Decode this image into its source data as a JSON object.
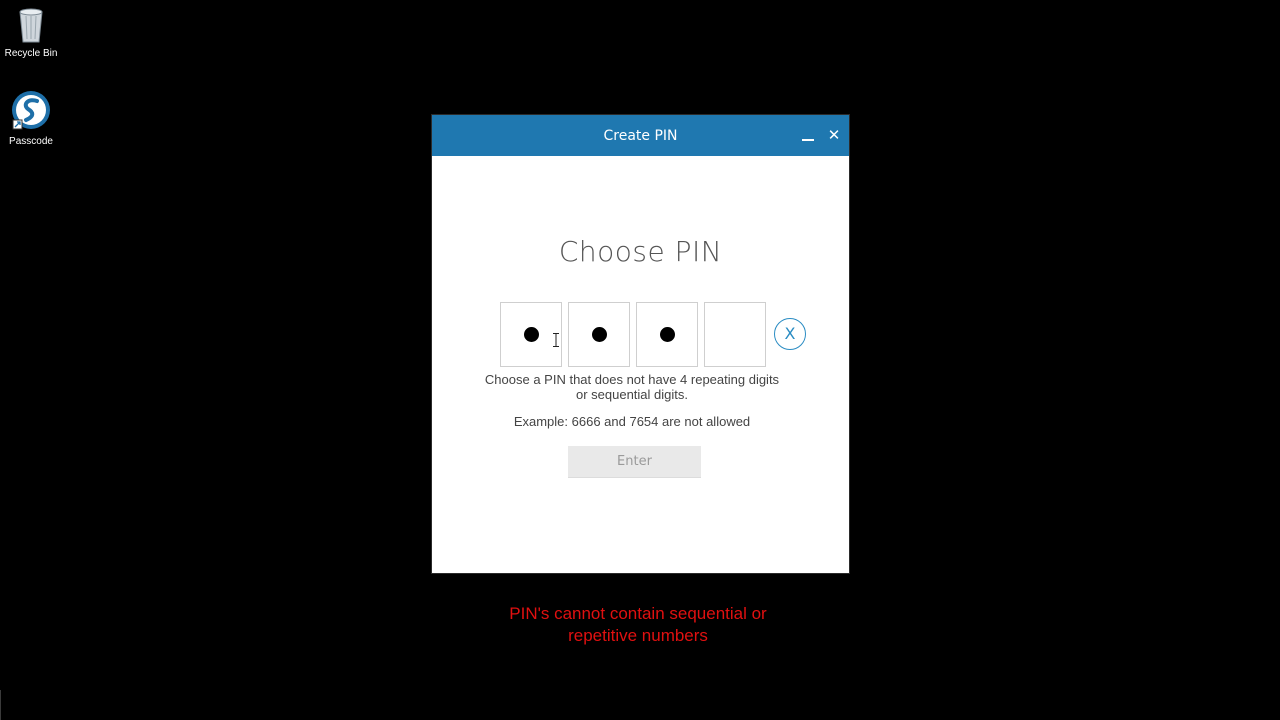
{
  "desktop": {
    "icons": [
      {
        "label": "Recycle Bin",
        "icon": "recycle-bin-icon"
      },
      {
        "label": "Passcode",
        "icon": "passcode-app-icon"
      }
    ]
  },
  "window": {
    "title": "Create PIN",
    "minimize_icon": "minimize-icon",
    "close_glyph": "✕",
    "heading": "Choose PIN",
    "pin": {
      "digits_total": 4,
      "digits_entered": 3,
      "clear_label": "X"
    },
    "hint_line1": "Choose a PIN that does not have 4 repeating digits",
    "hint_line2": "or sequential digits.",
    "example": "Example: 6666 and 7654 are not allowed",
    "enter_label": "Enter"
  },
  "caption": {
    "line1": "PIN's cannot contain sequential or",
    "line2": "repetitive numbers"
  },
  "colors": {
    "titlebar": "#1f78b0",
    "accent": "#2a8cc3",
    "caption": "#e01010",
    "desktop": "#000000"
  }
}
